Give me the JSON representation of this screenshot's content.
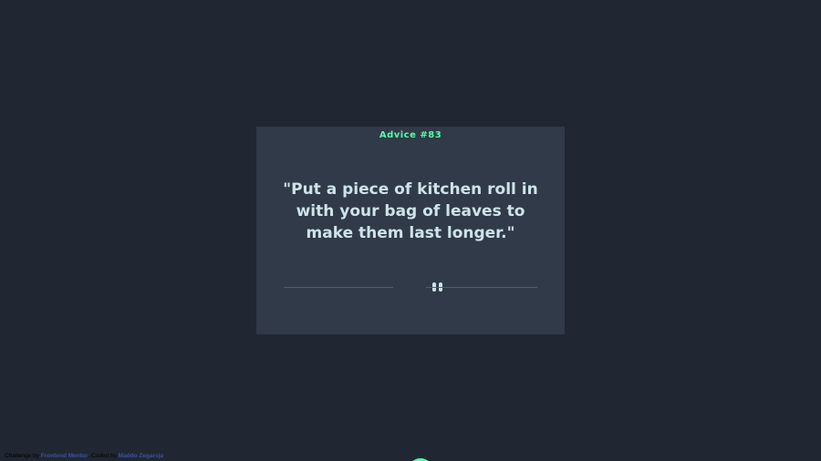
{
  "card": {
    "advice_id": "Advice #83",
    "advice_text": "\"Put a piece of kitchen roll in with your bag of leaves to make them last longer.\""
  },
  "divider": {
    "icon": "pause-icon"
  },
  "dice_button": {
    "icon": "dice-icon"
  },
  "attribution": {
    "prefix": "Challenge by",
    "link1": "Frontend Mentor",
    "middle": ". Coded by",
    "link2": "Maddo Zegarsja",
    "suffix": "."
  },
  "colors": {
    "background": "#202733",
    "card": "#313a48",
    "accent": "#53ffaa",
    "text": "#cee3e9",
    "divider": "#4f5d74",
    "link": "#3e52a3"
  }
}
